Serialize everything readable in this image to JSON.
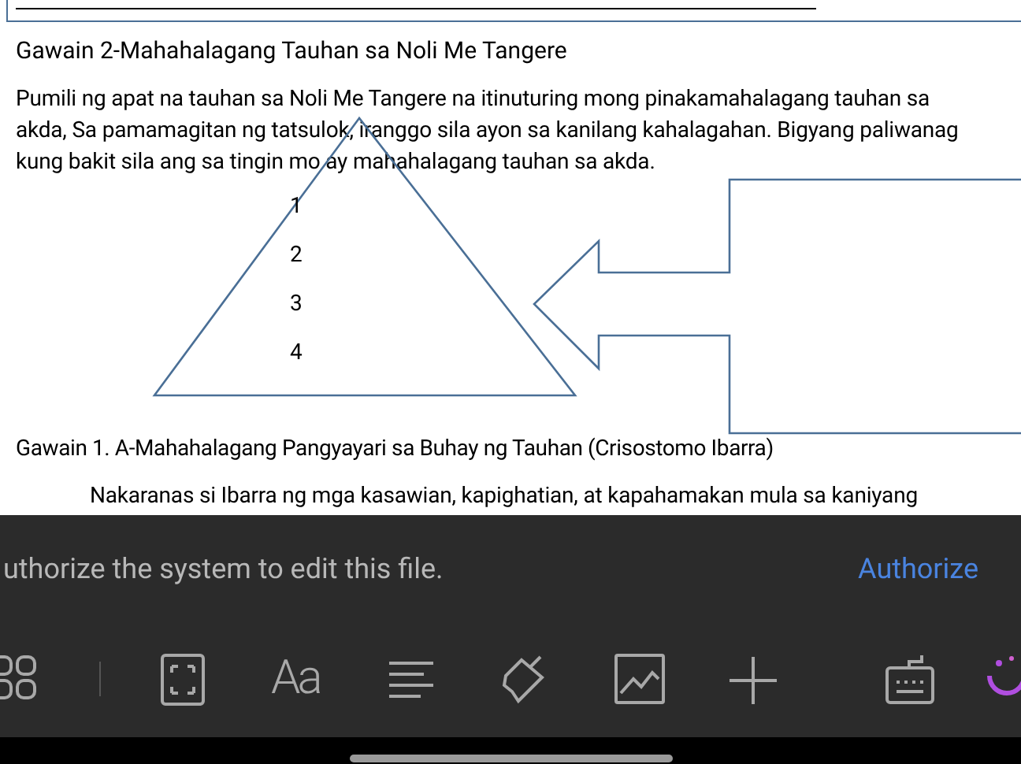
{
  "document": {
    "heading": "Gawain 2-Mahahalagang Tauhan sa Noli Me Tangere",
    "paragraph": "Pumili ng apat na tauhan sa Noli Me Tangere na itinuturing mong pinakamahalagang tauhan sa akda, Sa pamamagitan ng tatsulok, iranggo sila ayon sa kanilang kahalagahan. Bigyang paliwanag kung bakit sila ang sa tingin mo ay mahahalagang tauhan sa akda.",
    "triangle_ranks": [
      "1",
      "2",
      "3",
      "4"
    ],
    "heading_2": "Gawain 1. A-Mahahalagang Pangyayari sa Buhay ng Tauhan (Crisostomo Ibarra)",
    "paragraph_2": "Nakaranas si Ibarra ng mga kasawian, kapighatian, at kapahamakan mula sa kaniyang"
  },
  "banner": {
    "message": "uthorize the system to edit this file.",
    "action": "Authorize"
  },
  "toolbar": [
    {
      "kind": "grid"
    },
    {
      "kind": "divider"
    },
    {
      "kind": "frame"
    },
    {
      "kind": "font",
      "label": "Aa"
    },
    {
      "kind": "align"
    },
    {
      "kind": "brush"
    },
    {
      "kind": "image"
    },
    {
      "kind": "plus"
    },
    {
      "kind": "keyboard"
    },
    {
      "kind": "ai"
    }
  ]
}
